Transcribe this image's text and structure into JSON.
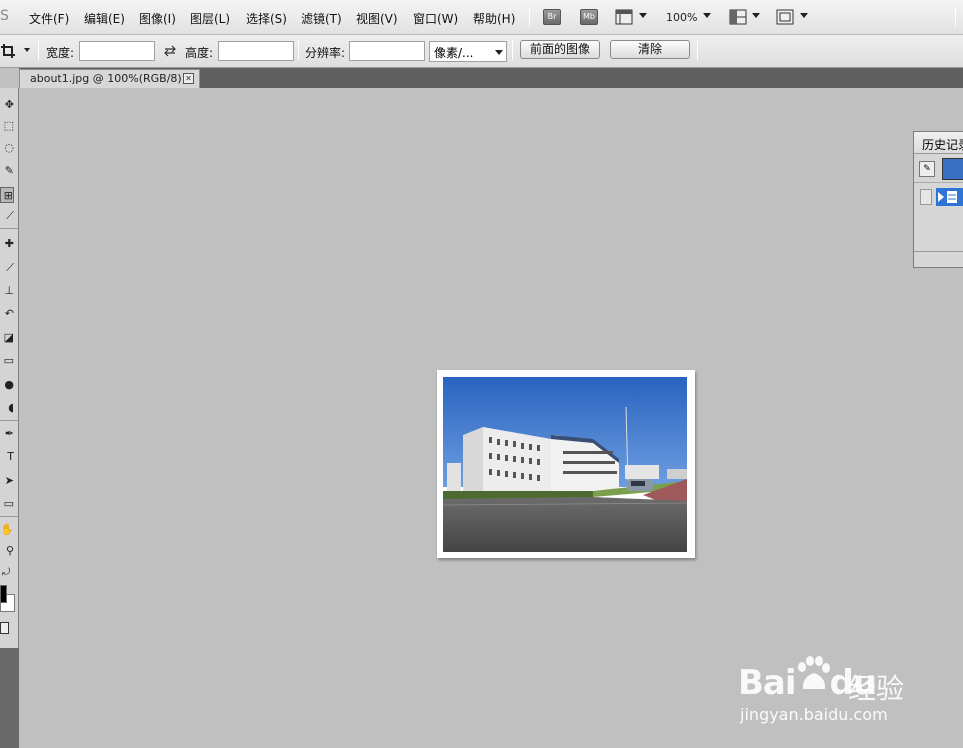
{
  "menubar": {
    "items": [
      "文件(F)",
      "编辑(E)",
      "图像(I)",
      "图层(L)",
      "选择(S)",
      "滤镜(T)",
      "视图(V)",
      "窗口(W)",
      "帮助(H)"
    ],
    "bridge_label": "Br",
    "minibridge_label": "Mb",
    "zoom_value": "100%",
    "view_icon": "view-extras-icon",
    "arrange_icon": "arrange-documents-icon",
    "screen_mode_icon": "screen-mode-icon"
  },
  "options": {
    "tool_icon": "crop-icon",
    "width_label": "宽度:",
    "width_value": "",
    "swap_icon": "swap-arrows-icon",
    "height_label": "高度:",
    "height_value": "",
    "resolution_label": "分辨率:",
    "resolution_value": "",
    "unit_select": "像素/...",
    "front_image_button": "前面的图像",
    "clear_button": "清除"
  },
  "document": {
    "tab_title": "about1.jpg @ 100%(RGB/8)",
    "tab_close": "✕"
  },
  "tools": [
    {
      "name": "move-tool",
      "glyph": "✥"
    },
    {
      "name": "marquee-tool",
      "glyph": "⬚"
    },
    {
      "name": "lasso-tool",
      "glyph": "◌"
    },
    {
      "name": "quick-select-tool",
      "glyph": "✎"
    },
    {
      "name": "crop-tool",
      "glyph": "⊞"
    },
    {
      "name": "eyedropper-tool",
      "glyph": "⟋"
    },
    {
      "name": "healing-brush-tool",
      "glyph": "✚"
    },
    {
      "name": "brush-tool",
      "glyph": "⟋"
    },
    {
      "name": "clone-stamp-tool",
      "glyph": "⊥"
    },
    {
      "name": "history-brush-tool",
      "glyph": "↶"
    },
    {
      "name": "eraser-tool",
      "glyph": "◪"
    },
    {
      "name": "gradient-tool",
      "glyph": "▭"
    },
    {
      "name": "blur-tool",
      "glyph": "●"
    },
    {
      "name": "dodge-tool",
      "glyph": "◖"
    },
    {
      "name": "pen-tool",
      "glyph": "✒"
    },
    {
      "name": "type-tool",
      "glyph": "T"
    },
    {
      "name": "path-select-tool",
      "glyph": "➤"
    },
    {
      "name": "shape-tool",
      "glyph": "▭"
    },
    {
      "name": "hand-tool",
      "glyph": "✋"
    },
    {
      "name": "zoom-tool",
      "glyph": "⚲"
    }
  ],
  "history_panel": {
    "title": "历史记录",
    "snapshot_icon": "brush-snapshot-icon",
    "state_icon": "history-state-icon"
  },
  "watermark": {
    "brand": "Bai",
    "brand_icon": "baidu-paw-icon",
    "brand2": "du",
    "cn": "经验",
    "url": "jingyan.baidu.com"
  },
  "colors": {
    "canvas_bg": "#c0c0c0",
    "tab_bar_bg": "#5f5f5f",
    "selection_blue": "#2f75d6"
  }
}
